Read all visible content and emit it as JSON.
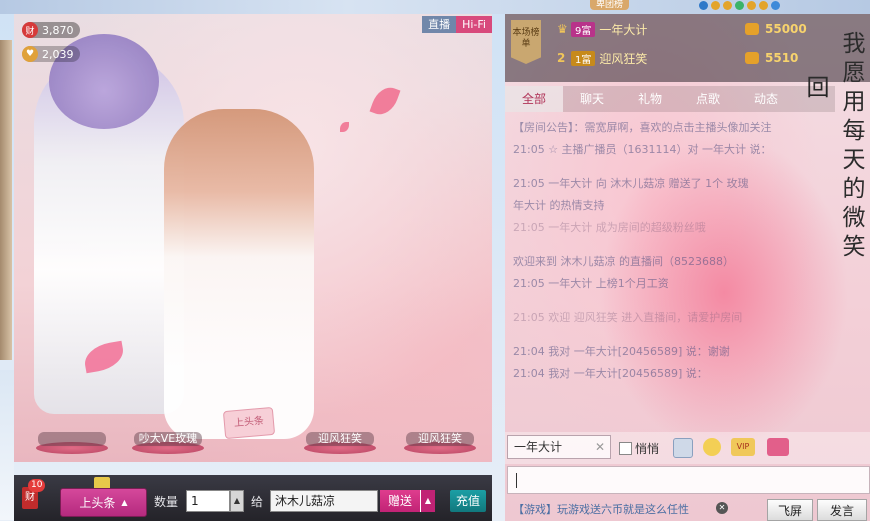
{
  "top": {
    "ranking_tab": "卑团榜"
  },
  "video": {
    "wealth_value": "3,870",
    "wealth_icon_text": "财",
    "fans_value": "2,039",
    "live_label": "直播",
    "hifi_label": "Hi-Fi",
    "gifts": [
      "",
      "吵大VE玫瑰",
      "迎风狂笑",
      "迎风狂笑"
    ],
    "sign_text": "上头条"
  },
  "bottom": {
    "rich_badge": "财",
    "rich_count": "10",
    "headline_btn": "上头条",
    "qty_label": "数量",
    "qty_value": "1",
    "give_label": "给",
    "target_name": "沐木儿菇凉",
    "send_btn": "赠送",
    "recharge_btn": "充值"
  },
  "rank": {
    "badge": "本场榜单",
    "rows": [
      {
        "num": "",
        "level": "9富",
        "name": "一年大计",
        "score": "55000"
      },
      {
        "num": "2",
        "level": "1富",
        "name": "迎风狂笑",
        "score": "5510"
      }
    ]
  },
  "poem": {
    "col1": "我愿用每天的微笑",
    "col2": "回"
  },
  "tabs": [
    "全部",
    "聊天",
    "礼物",
    "点歌",
    "动态"
  ],
  "chat_lines": [
    "【房间公告】：需宽屏啊，喜欢的点击主播头像加关注",
    "21:05 ☆ 主播广播员（1631114）对 一年大计 说：",
    "21:05 一年大计 向 沐木儿菇凉 赠送了 1个 玫瑰",
    "年大计 的热情支持",
    "21:05 一年大计 成为房间的超级粉丝哦",
    "欢迎来到 沐木儿菇凉 的直播间（8523688）",
    "21:05 一年大计 上榜1个月工资",
    "21:05 欢迎 迎风狂笑 进入直播间，请爱护房间",
    "21:04 我对 一年大计[20456589] 说：谢谢",
    "21:04 我对 一年大计[20456589] 说："
  ],
  "controls": {
    "chat_target": "一年大计",
    "whisper": "悄悄",
    "vip": "VIP"
  },
  "footer": {
    "game_text": "【游戏】玩游戏送六币就是这么任性",
    "fly_btn": "飞屏",
    "speak_btn": "发言"
  }
}
